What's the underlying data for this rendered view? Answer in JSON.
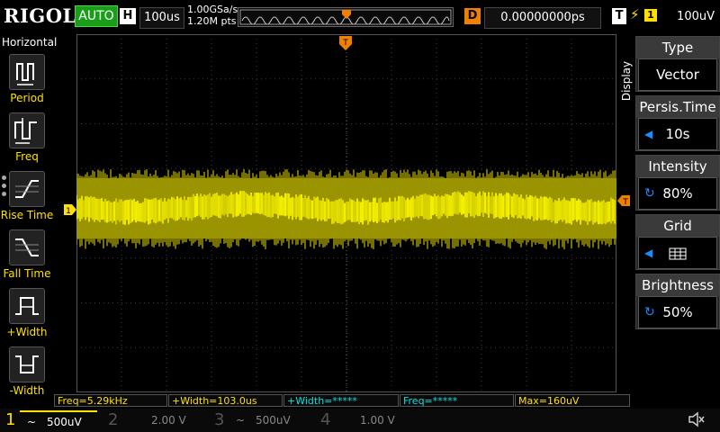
{
  "brand": "RIGOL",
  "run_status": "AUTO",
  "horizontal": {
    "badge": "H",
    "timebase": "100us",
    "sample_rate": "1.00GSa/s",
    "points": "1.20M pts"
  },
  "delay": {
    "badge": "D",
    "value": "0.00000000ps"
  },
  "trigger": {
    "badge": "T",
    "edge_icon": "rising-edge-icon",
    "channel": "1",
    "level": "100uV"
  },
  "left_menu": {
    "title": "Horizontal",
    "items": [
      {
        "label": "Period",
        "icon": "period-icon"
      },
      {
        "label": "Freq",
        "icon": "freq-icon"
      },
      {
        "label": "Rise Time",
        "icon": "rise-time-icon"
      },
      {
        "label": "Fall Time",
        "icon": "fall-time-icon"
      },
      {
        "label": "+Width",
        "icon": "positive-width-icon"
      },
      {
        "label": "-Width",
        "icon": "negative-width-icon"
      }
    ]
  },
  "right_menu": {
    "title": "Display",
    "items": [
      {
        "title": "Type",
        "value": "Vector"
      },
      {
        "title": "Persis.Time",
        "value": "10s"
      },
      {
        "title": "Intensity",
        "value": "80%"
      },
      {
        "title": "Grid",
        "value": "grid-icon"
      },
      {
        "title": "Brightness",
        "value": "50%"
      }
    ]
  },
  "measurements": [
    {
      "text": "Freq=5.29kHz",
      "color": "#ffe000"
    },
    {
      "text": "+Width=103.0us",
      "color": "#ffe000"
    },
    {
      "text": "+Width=*****",
      "color": "#00e5e5"
    },
    {
      "text": "Freq=*****",
      "color": "#00e5e5"
    },
    {
      "text": "Max=160uV",
      "color": "#ffe000"
    }
  ],
  "channels": [
    {
      "num": "1",
      "coupling": "~",
      "scale": "500uV",
      "color": "#ffe000",
      "active": true
    },
    {
      "num": "2",
      "coupling": "",
      "scale": "2.00 V",
      "color": "#00a0a0",
      "active": false
    },
    {
      "num": "3",
      "coupling": "~",
      "scale": "500uV",
      "color": "#c040c0",
      "active": false
    },
    {
      "num": "4",
      "coupling": "",
      "scale": "1.00 V",
      "color": "#3060ff",
      "active": false
    }
  ],
  "colors": {
    "ch1": "#ffe000",
    "trace": "#f6f000",
    "trace_dim": "#9a9400",
    "grid": "#3a3a3a",
    "trigger": "#f08000"
  }
}
